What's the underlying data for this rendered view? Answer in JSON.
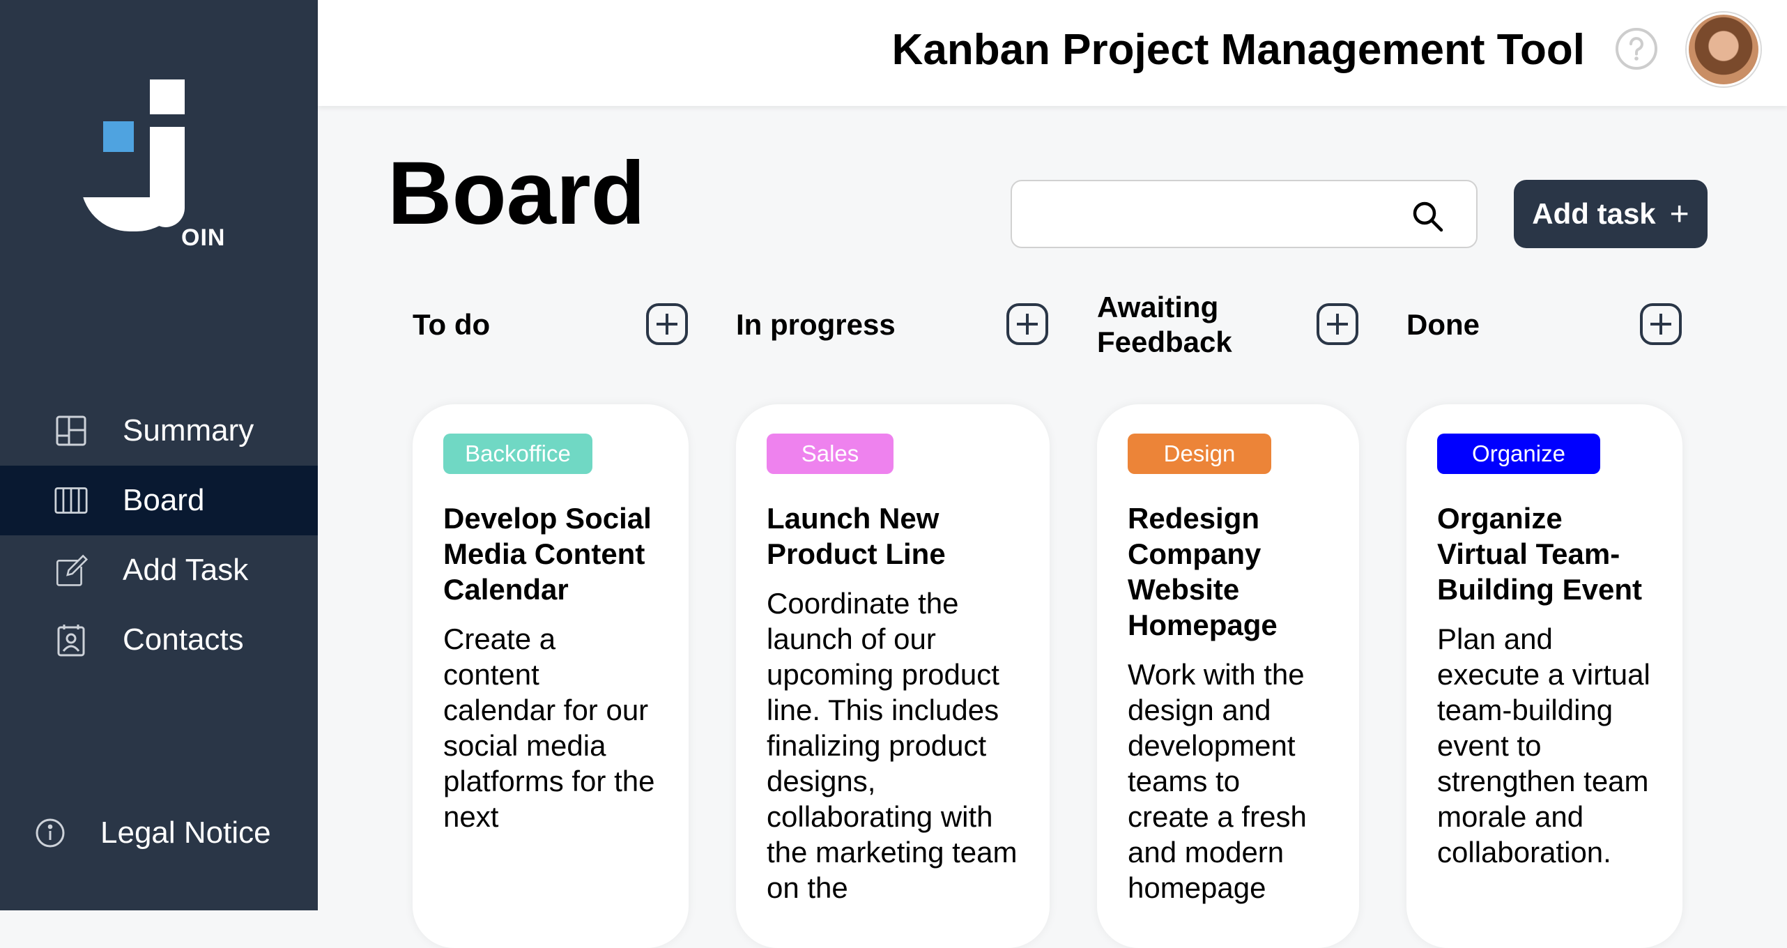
{
  "app": {
    "title": "Kanban Project Management Tool",
    "logo_text": "OIN"
  },
  "sidebar": {
    "items": [
      {
        "label": "Summary",
        "icon": "summary-icon",
        "active": false
      },
      {
        "label": "Board",
        "icon": "board-icon",
        "active": true
      },
      {
        "label": "Add Task",
        "icon": "add-task-icon",
        "active": false
      },
      {
        "label": "Contacts",
        "icon": "contacts-icon",
        "active": false
      }
    ],
    "legal": {
      "label": "Legal Notice",
      "icon": "info-icon"
    }
  },
  "main": {
    "title": "Board",
    "search": {
      "placeholder": "",
      "value": ""
    },
    "add_task_label": "Add task",
    "add_task_plus": "+"
  },
  "columns": [
    {
      "title": "To do"
    },
    {
      "title": "In progress"
    },
    {
      "title": "Awaiting Feedback"
    },
    {
      "title": "Done"
    }
  ],
  "cards": [
    {
      "category": "Backoffice",
      "category_color": "#70d8c4",
      "title": "Develop Social Media Content Calendar",
      "description": "Create a content calendar for our social media platforms for the next"
    },
    {
      "category": "Sales",
      "category_color": "#ee82ee",
      "title": "Launch New Product Line",
      "description": "Coordinate the launch of our upcoming product line. This includes finalizing product designs, collaborating with the marketing team on the"
    },
    {
      "category": "Design",
      "category_color": "#ec8438",
      "title": "Redesign Company Website Homepage",
      "description": "Work with the design and development teams to create a fresh and modern homepage"
    },
    {
      "category": "Organize",
      "category_color": "#0000ff",
      "title": "Organize Virtual Team-Building Event",
      "description": "Plan and execute a virtual team-building event to strengthen team morale and collaboration."
    }
  ],
  "colors": {
    "sidebar": "#2a3647",
    "sidebar_active": "#091931",
    "accent_blue": "#4fa3e0"
  }
}
